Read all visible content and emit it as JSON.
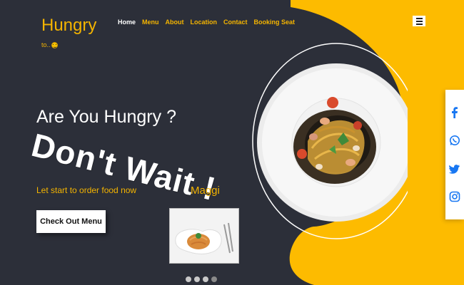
{
  "brand": {
    "name": "Hungry",
    "tagline": "to.."
  },
  "nav": {
    "items": [
      "Home",
      "Menu",
      "About",
      "Location",
      "Contact",
      "Booking Seat"
    ],
    "active": "Home"
  },
  "hero": {
    "headline": "Are You Hungry ?",
    "slogan": "Don't Wait !",
    "subtitle": "Let start to order food now",
    "cta_label": "Check Out Menu"
  },
  "featured": {
    "dish_caption": "Maggi"
  },
  "carousel": {
    "slide_count": 4,
    "active_index": 3
  },
  "social": {
    "icons": [
      "facebook-icon",
      "whatsapp-icon",
      "twitter-icon",
      "instagram-icon"
    ]
  },
  "colors": {
    "dark_bg": "#2c2f39",
    "accent": "#f4b400",
    "social_blue": "#1877f2"
  }
}
